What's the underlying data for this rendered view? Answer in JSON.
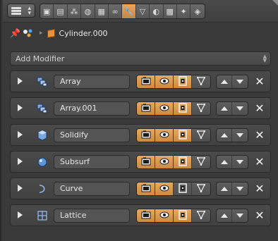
{
  "header": {
    "editor_icon": "properties-editor-icon",
    "context_tabs": [
      {
        "icon": "render-icon",
        "glyph": "▣",
        "active": false
      },
      {
        "icon": "render-layers-icon",
        "glyph": "▤",
        "active": false
      },
      {
        "icon": "scene-icon",
        "glyph": "⁂",
        "active": false
      },
      {
        "icon": "world-icon",
        "glyph": "◍",
        "active": false
      },
      {
        "icon": "object-icon",
        "glyph": "▦",
        "active": false
      },
      {
        "icon": "constraints-icon",
        "glyph": "∞",
        "active": false
      },
      {
        "icon": "modifiers-wrench-icon",
        "glyph": "🔧",
        "active": true
      },
      {
        "icon": "object-data-icon",
        "glyph": "▽",
        "active": false
      },
      {
        "icon": "material-icon",
        "glyph": "◐",
        "active": false
      },
      {
        "icon": "texture-icon",
        "glyph": "▩",
        "active": false
      },
      {
        "icon": "particles-icon",
        "glyph": "✦",
        "active": false
      },
      {
        "icon": "physics-icon",
        "glyph": "◈",
        "active": false
      }
    ]
  },
  "breadcrumb": {
    "pin_icon": "pin-icon",
    "scene_icon": "scene-icon",
    "object_icon": "mesh-object-icon",
    "object_name": "Cylinder.000"
  },
  "add_modifier": {
    "label": "Add Modifier"
  },
  "colors": {
    "accent": "#e09a4e",
    "panel": "#444444",
    "background": "#393939"
  },
  "modifiers": [
    {
      "name": "Array",
      "icon": "array-modifier-icon",
      "render": true,
      "realtime": true,
      "editmode": true,
      "cage": false
    },
    {
      "name": "Array.001",
      "icon": "array-modifier-icon",
      "render": true,
      "realtime": true,
      "editmode": true,
      "cage": false
    },
    {
      "name": "Solidify",
      "icon": "solidify-modifier-icon",
      "render": true,
      "realtime": true,
      "editmode": true,
      "cage": false
    },
    {
      "name": "Subsurf",
      "icon": "subsurf-modifier-icon",
      "render": true,
      "realtime": true,
      "editmode": true,
      "cage": false
    },
    {
      "name": "Curve",
      "icon": "curve-modifier-icon",
      "render": true,
      "realtime": true,
      "editmode": false,
      "cage": false
    },
    {
      "name": "Lattice",
      "icon": "lattice-modifier-icon",
      "render": true,
      "realtime": true,
      "editmode": true,
      "cage": false
    }
  ]
}
